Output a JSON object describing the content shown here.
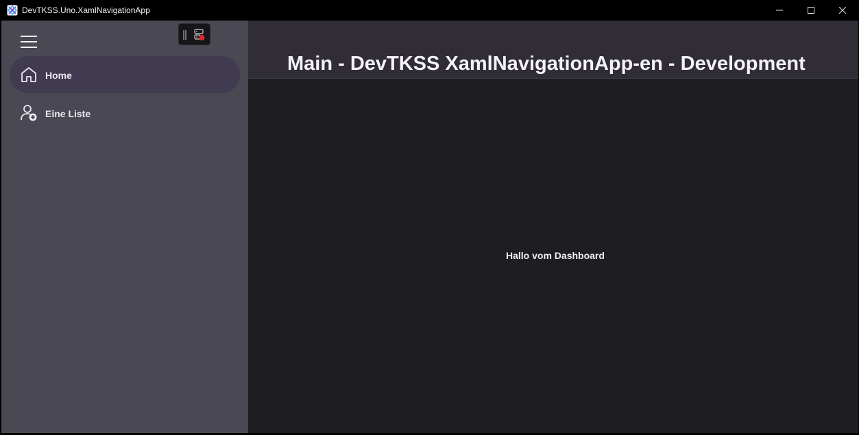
{
  "window": {
    "title": "DevTKSS.Uno.XamlNavigationApp"
  },
  "nav": {
    "items": [
      {
        "label": "Home",
        "icon": "home-icon",
        "selected": true
      },
      {
        "label": "Eine Liste",
        "icon": "user-add-icon",
        "selected": false
      }
    ]
  },
  "header": {
    "title": "Main - DevTKSS XamlNavigationApp-en - Development"
  },
  "content": {
    "text": "Hallo vom Dashboard"
  },
  "colors": {
    "nav_background": "#4a4852",
    "nav_selected": "#413b51",
    "header_background": "#302d37",
    "content_background": "#1e1d22",
    "debug_indicator": "#e0282c"
  }
}
